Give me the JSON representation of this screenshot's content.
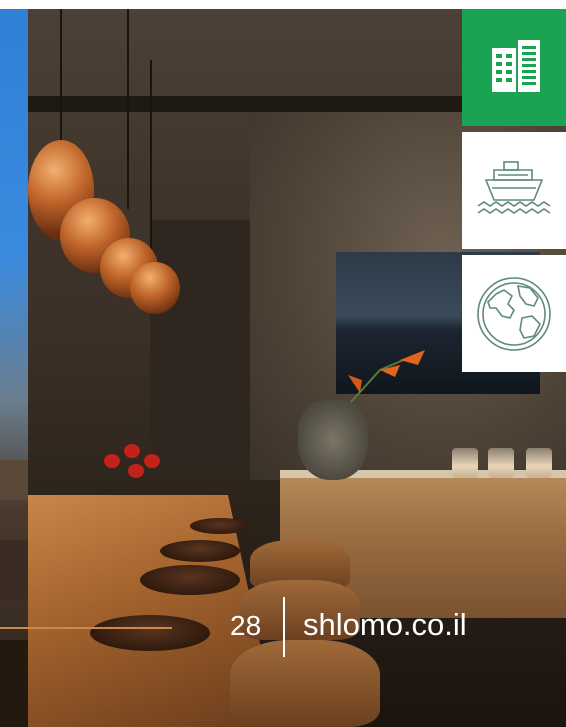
{
  "footer": {
    "page_number": "28",
    "website": "shlomo.co.il"
  },
  "side_menu": {
    "items": [
      {
        "icon": "building-icon",
        "state": "active"
      },
      {
        "icon": "ship-icon",
        "state": "inactive"
      },
      {
        "icon": "globe-icon",
        "state": "inactive"
      }
    ]
  },
  "colors": {
    "accent_green": "#1aa352",
    "icon_outline": "#5f8a7e",
    "footer_line": "#c98a4a",
    "text": "#ffffff"
  }
}
